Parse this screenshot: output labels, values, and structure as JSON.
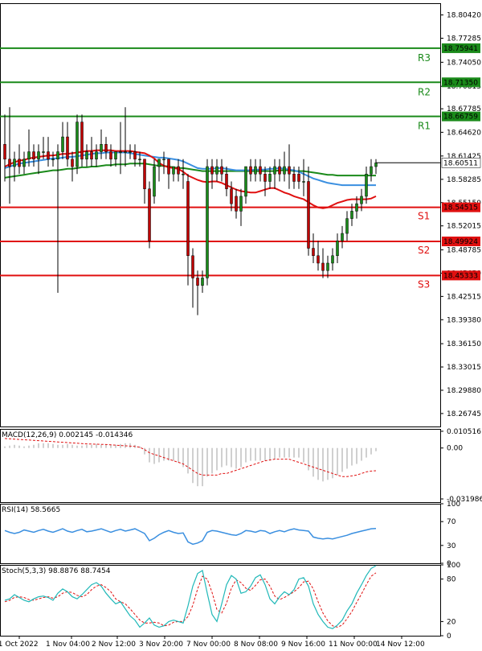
{
  "chart_data": [
    {
      "type": "candlestick",
      "ylim": [
        18.25,
        18.82
      ],
      "y_ticks": [
        "18.80420",
        "18.77285",
        "18.74050",
        "18.70815",
        "18.67785",
        "18.64620",
        "18.61425",
        "18.58285",
        "18.55150",
        "18.52015",
        "18.48785",
        "18.45650",
        "18.42515",
        "18.39380",
        "18.36150",
        "18.33015",
        "18.29880",
        "18.26745"
      ],
      "x_ticks": [
        "31 Oct 2022",
        "1 Nov 04:00",
        "2 Nov 12:00",
        "3 Nov 20:00",
        "7 Nov 00:00",
        "8 Nov 08:00",
        "9 Nov 16:00",
        "11 Nov 00:00",
        "14 Nov 12:00"
      ],
      "last_price": "18.60511",
      "levels": [
        {
          "name": "R3",
          "value": 18.75941,
          "label": "18.75941",
          "color": "#1a8a1a"
        },
        {
          "name": "R2",
          "value": 18.7135,
          "label": "18.71350",
          "color": "#1a8a1a"
        },
        {
          "name": "R1",
          "value": 18.66759,
          "label": "18.66759",
          "color": "#1a8a1a"
        },
        {
          "name": "S1",
          "value": 18.54515,
          "label": "18.54515",
          "color": "#e01010"
        },
        {
          "name": "S2",
          "value": 18.49924,
          "label": "18.49924",
          "color": "#e01010"
        },
        {
          "name": "S3",
          "value": 18.45333,
          "label": "18.45333",
          "color": "#e01010"
        }
      ],
      "candles": [
        [
          18.63,
          18.67,
          18.58,
          18.61
        ],
        [
          18.61,
          18.68,
          18.55,
          18.6
        ],
        [
          18.6,
          18.62,
          18.58,
          18.61
        ],
        [
          18.61,
          18.63,
          18.59,
          18.6
        ],
        [
          18.6,
          18.62,
          18.59,
          18.61
        ],
        [
          18.61,
          18.65,
          18.6,
          18.62
        ],
        [
          18.62,
          18.63,
          18.6,
          18.61
        ],
        [
          18.61,
          18.63,
          18.59,
          18.62
        ],
        [
          18.62,
          18.64,
          18.61,
          18.62
        ],
        [
          18.62,
          18.64,
          18.6,
          18.61
        ],
        [
          18.61,
          18.62,
          18.6,
          18.61
        ],
        [
          18.61,
          18.63,
          18.43,
          18.62
        ],
        [
          18.62,
          18.66,
          18.61,
          18.64
        ],
        [
          18.64,
          18.66,
          18.6,
          18.61
        ],
        [
          18.61,
          18.62,
          18.58,
          18.6
        ],
        [
          18.6,
          18.67,
          18.59,
          18.66
        ],
        [
          18.66,
          18.67,
          18.6,
          18.61
        ],
        [
          18.61,
          18.63,
          18.6,
          18.62
        ],
        [
          18.62,
          18.64,
          18.6,
          18.61
        ],
        [
          18.61,
          18.63,
          18.6,
          18.62
        ],
        [
          18.62,
          18.65,
          18.61,
          18.63
        ],
        [
          18.63,
          18.64,
          18.61,
          18.62
        ],
        [
          18.62,
          18.63,
          18.6,
          18.61
        ],
        [
          18.61,
          18.62,
          18.6,
          18.62
        ],
        [
          18.62,
          18.66,
          18.59,
          18.62
        ],
        [
          18.62,
          18.68,
          18.6,
          18.62
        ],
        [
          18.62,
          18.63,
          18.61,
          18.62
        ],
        [
          18.62,
          18.63,
          18.6,
          18.61
        ],
        [
          18.61,
          18.62,
          18.6,
          18.61
        ],
        [
          18.61,
          18.61,
          18.55,
          18.57
        ],
        [
          18.57,
          18.58,
          18.49,
          18.5
        ],
        [
          18.56,
          18.61,
          18.55,
          18.6
        ],
        [
          18.6,
          18.61,
          18.58,
          18.61
        ],
        [
          18.61,
          18.62,
          18.59,
          18.61
        ],
        [
          18.61,
          18.61,
          18.57,
          18.59
        ],
        [
          18.59,
          18.6,
          18.58,
          18.6
        ],
        [
          18.6,
          18.61,
          18.58,
          18.59
        ],
        [
          18.59,
          18.61,
          18.57,
          18.59
        ],
        [
          18.58,
          18.59,
          18.44,
          18.48
        ],
        [
          18.48,
          18.49,
          18.41,
          18.45
        ],
        [
          18.45,
          18.46,
          18.4,
          18.44
        ],
        [
          18.44,
          18.46,
          18.43,
          18.45
        ],
        [
          18.45,
          18.61,
          18.44,
          18.6
        ],
        [
          18.6,
          18.61,
          18.57,
          18.59
        ],
        [
          18.59,
          18.61,
          18.58,
          18.6
        ],
        [
          18.6,
          18.61,
          18.58,
          18.59
        ],
        [
          18.59,
          18.6,
          18.56,
          18.57
        ],
        [
          18.57,
          18.58,
          18.54,
          18.55
        ],
        [
          18.56,
          18.57,
          18.53,
          18.54
        ],
        [
          18.54,
          18.57,
          18.52,
          18.56
        ],
        [
          18.56,
          18.6,
          18.55,
          18.6
        ],
        [
          18.6,
          18.61,
          18.58,
          18.59
        ],
        [
          18.59,
          18.61,
          18.58,
          18.6
        ],
        [
          18.6,
          18.61,
          18.58,
          18.59
        ],
        [
          18.59,
          18.6,
          18.56,
          18.58
        ],
        [
          18.58,
          18.6,
          18.57,
          18.59
        ],
        [
          18.59,
          18.61,
          18.57,
          18.6
        ],
        [
          18.6,
          18.61,
          18.58,
          18.59
        ],
        [
          18.59,
          18.62,
          18.58,
          18.6
        ],
        [
          18.6,
          18.63,
          18.57,
          18.59
        ],
        [
          18.59,
          18.6,
          18.57,
          18.58
        ],
        [
          18.59,
          18.6,
          18.57,
          18.58
        ],
        [
          18.58,
          18.61,
          18.56,
          18.58
        ],
        [
          18.58,
          18.6,
          18.48,
          18.49
        ],
        [
          18.49,
          18.51,
          18.47,
          18.48
        ],
        [
          18.48,
          18.5,
          18.46,
          18.47
        ],
        [
          18.47,
          18.49,
          18.45,
          18.46
        ],
        [
          18.46,
          18.48,
          18.45,
          18.47
        ],
        [
          18.47,
          18.49,
          18.46,
          18.48
        ],
        [
          18.48,
          18.51,
          18.47,
          18.5
        ],
        [
          18.5,
          18.52,
          18.49,
          18.51
        ],
        [
          18.51,
          18.54,
          18.5,
          18.53
        ],
        [
          18.53,
          18.55,
          18.52,
          18.54
        ],
        [
          18.54,
          18.56,
          18.53,
          18.55
        ],
        [
          18.55,
          18.57,
          18.54,
          18.56
        ],
        [
          18.56,
          18.6,
          18.55,
          18.59
        ],
        [
          18.59,
          18.61,
          18.58,
          18.6
        ],
        [
          18.6,
          18.61,
          18.59,
          18.605
        ]
      ],
      "ma_red": [
        18.6,
        18.603,
        18.606,
        18.608,
        18.609,
        18.611,
        18.612,
        18.613,
        18.614,
        18.615,
        18.615,
        18.616,
        18.617,
        18.617,
        18.618,
        18.619,
        18.62,
        18.621,
        18.621,
        18.622,
        18.622,
        18.622,
        18.622,
        18.621,
        18.621,
        18.621,
        18.621,
        18.62,
        18.619,
        18.618,
        18.615,
        18.611,
        18.605,
        18.601,
        18.599,
        18.598,
        18.597,
        18.593,
        18.588,
        18.585,
        18.582,
        18.58,
        18.579,
        18.58,
        18.58,
        18.578,
        18.575,
        18.572,
        18.569,
        18.567,
        18.566,
        18.565,
        18.565,
        18.567,
        18.569,
        18.571,
        18.571,
        18.568,
        18.565,
        18.563,
        18.56,
        18.558,
        18.556,
        18.552,
        18.548,
        18.545,
        18.544,
        18.545,
        18.548,
        18.551,
        18.553,
        18.555,
        18.556,
        18.556,
        18.556,
        18.556,
        18.557,
        18.56
      ],
      "ma_blue": [
        18.598,
        18.6,
        18.602,
        18.604,
        18.605,
        18.606,
        18.607,
        18.608,
        18.609,
        18.61,
        18.611,
        18.611,
        18.612,
        18.613,
        18.613,
        18.614,
        18.615,
        18.616,
        18.617,
        18.618,
        18.618,
        18.619,
        18.619,
        18.619,
        18.619,
        18.619,
        18.618,
        18.617,
        18.616,
        18.615,
        18.614,
        18.613,
        18.612,
        18.612,
        18.611,
        18.61,
        18.609,
        18.607,
        18.604,
        18.601,
        18.598,
        18.597,
        18.597,
        18.597,
        18.598,
        18.598,
        18.597,
        18.596,
        18.595,
        18.595,
        18.595,
        18.595,
        18.596,
        18.596,
        18.596,
        18.597,
        18.597,
        18.598,
        18.597,
        18.596,
        18.595,
        18.593,
        18.59,
        18.587,
        18.584,
        18.582,
        18.58,
        18.578,
        18.577,
        18.576,
        18.575,
        18.575,
        18.575,
        18.575,
        18.575,
        18.575,
        18.575,
        18.575
      ],
      "ma_green": [
        18.585,
        18.586,
        18.587,
        18.588,
        18.589,
        18.59,
        18.591,
        18.592,
        18.593,
        18.594,
        18.595,
        18.595,
        18.596,
        18.597,
        18.597,
        18.598,
        18.599,
        18.599,
        18.6,
        18.6,
        18.601,
        18.602,
        18.602,
        18.603,
        18.603,
        18.603,
        18.604,
        18.604,
        18.604,
        18.604,
        18.603,
        18.602,
        18.601,
        18.601,
        18.6,
        18.599,
        18.598,
        18.598,
        18.597,
        18.596,
        18.595,
        18.594,
        18.594,
        18.594,
        18.594,
        18.594,
        18.594,
        18.594,
        18.594,
        18.594,
        18.594,
        18.594,
        18.594,
        18.594,
        18.594,
        18.594,
        18.594,
        18.595,
        18.595,
        18.595,
        18.594,
        18.594,
        18.594,
        18.593,
        18.592,
        18.591,
        18.59,
        18.589,
        18.589,
        18.588,
        18.588,
        18.588,
        18.588,
        18.588,
        18.588,
        18.588,
        18.588,
        18.588
      ]
    },
    {
      "type": "bar",
      "label": "MACD(12,26,9) 0.002145 -0.014346",
      "ylim": [
        -0.034,
        0.012
      ],
      "y_ticks": [
        {
          "value": 0.010516,
          "label": "0.010516"
        },
        {
          "value": 0,
          "label": "0.00"
        },
        {
          "value": -0.031986,
          "label": "-0.031986"
        }
      ],
      "histogram": [
        0.001,
        0.0015,
        0.002,
        0.0015,
        0.001,
        0.0015,
        0.002,
        0.003,
        0.003,
        0.003,
        0.0025,
        0.002,
        0.002,
        0.0025,
        0.002,
        0.0015,
        0.0015,
        0.002,
        0.002,
        0.0025,
        0.002,
        0.002,
        0.002,
        0.002,
        0.0025,
        0.003,
        0.003,
        0.002,
        0.001,
        -0.004,
        -0.009,
        -0.01,
        -0.009,
        -0.008,
        -0.008,
        -0.008,
        -0.009,
        -0.012,
        -0.016,
        -0.022,
        -0.024,
        -0.024,
        -0.018,
        -0.016,
        -0.014,
        -0.012,
        -0.011,
        -0.012,
        -0.013,
        -0.012,
        -0.009,
        -0.008,
        -0.008,
        -0.008,
        -0.008,
        -0.008,
        -0.007,
        -0.006,
        -0.006,
        -0.006,
        -0.006,
        -0.006,
        -0.009,
        -0.014,
        -0.018,
        -0.02,
        -0.021,
        -0.02,
        -0.019,
        -0.017,
        -0.015,
        -0.013,
        -0.011,
        -0.01,
        -0.008,
        -0.006,
        -0.004,
        -0.002
      ],
      "signal": [
        0.006,
        0.0058,
        0.0056,
        0.0054,
        0.0052,
        0.005,
        0.0048,
        0.0046,
        0.0044,
        0.0042,
        0.004,
        0.0038,
        0.0036,
        0.0034,
        0.0032,
        0.003,
        0.0028,
        0.0026,
        0.0025,
        0.0024,
        0.0023,
        0.0022,
        0.002,
        0.0018,
        0.0016,
        0.0014,
        0.0012,
        0.001,
        0.0005,
        -0.001,
        -0.003,
        -0.004,
        -0.005,
        -0.006,
        -0.007,
        -0.008,
        -0.009,
        -0.01,
        -0.012,
        -0.014,
        -0.016,
        -0.017,
        -0.017,
        -0.017,
        -0.017,
        -0.016,
        -0.016,
        -0.015,
        -0.014,
        -0.013,
        -0.012,
        -0.011,
        -0.01,
        -0.009,
        -0.008,
        -0.0075,
        -0.007,
        -0.007,
        -0.007,
        -0.007,
        -0.008,
        -0.009,
        -0.01,
        -0.011,
        -0.012,
        -0.013,
        -0.014,
        -0.015,
        -0.016,
        -0.017,
        -0.018,
        -0.018,
        -0.0175,
        -0.017,
        -0.016,
        -0.015,
        -0.0145,
        -0.0143
      ]
    },
    {
      "type": "line",
      "label": "RSI(14) 58.5665",
      "ylim": [
        0,
        100
      ],
      "y_ticks": [
        {
          "value": 100,
          "label": "100"
        },
        {
          "value": 70,
          "label": "70"
        },
        {
          "value": 30,
          "label": "30"
        },
        {
          "value": 0,
          "label": "0"
        }
      ],
      "values": [
        55,
        52,
        50,
        52,
        56,
        54,
        52,
        55,
        57,
        54,
        52,
        55,
        58,
        54,
        52,
        55,
        57,
        53,
        54,
        56,
        58,
        55,
        52,
        55,
        57,
        54,
        56,
        58,
        54,
        50,
        38,
        42,
        48,
        52,
        55,
        52,
        50,
        51,
        36,
        32,
        34,
        38,
        52,
        55,
        54,
        52,
        50,
        48,
        47,
        50,
        55,
        54,
        52,
        55,
        54,
        50,
        53,
        55,
        53,
        56,
        58,
        56,
        55,
        54,
        44,
        42,
        41,
        42,
        41,
        43,
        45,
        47,
        50,
        52,
        54,
        56,
        58,
        58.5
      ]
    },
    {
      "type": "line",
      "label": "Stoch(5,3,3) 98.8876 88.7454",
      "ylim": [
        0,
        100
      ],
      "y_ticks": [
        {
          "value": 100,
          "label": "100"
        },
        {
          "value": 80,
          "label": "80"
        },
        {
          "value": 20,
          "label": "20"
        },
        {
          "value": 0,
          "label": "0"
        }
      ],
      "k": [
        50,
        52,
        58,
        54,
        50,
        48,
        52,
        55,
        56,
        54,
        50,
        60,
        66,
        62,
        55,
        52,
        58,
        65,
        72,
        75,
        70,
        60,
        52,
        45,
        48,
        38,
        28,
        22,
        12,
        18,
        25,
        15,
        12,
        14,
        20,
        22,
        20,
        18,
        42,
        70,
        88,
        92,
        60,
        30,
        20,
        45,
        72,
        85,
        80,
        60,
        62,
        70,
        82,
        86,
        72,
        52,
        45,
        55,
        62,
        58,
        65,
        80,
        82,
        70,
        45,
        30,
        20,
        12,
        10,
        15,
        22,
        35,
        45,
        60,
        72,
        85,
        95,
        98.9
      ],
      "d": [
        48,
        50,
        54,
        55,
        54,
        51,
        50,
        52,
        54,
        55,
        53,
        55,
        60,
        62,
        61,
        57,
        55,
        58,
        65,
        70,
        72,
        68,
        62,
        52,
        48,
        45,
        38,
        30,
        22,
        18,
        18,
        19,
        18,
        14,
        15,
        19,
        20,
        20,
        27,
        43,
        66,
        84,
        80,
        61,
        37,
        32,
        46,
        67,
        79,
        75,
        67,
        64,
        71,
        79,
        80,
        70,
        56,
        51,
        54,
        58,
        62,
        68,
        76,
        77,
        66,
        48,
        32,
        21,
        14,
        12,
        15,
        24,
        34,
        47,
        59,
        72,
        84,
        88.7
      ]
    }
  ]
}
